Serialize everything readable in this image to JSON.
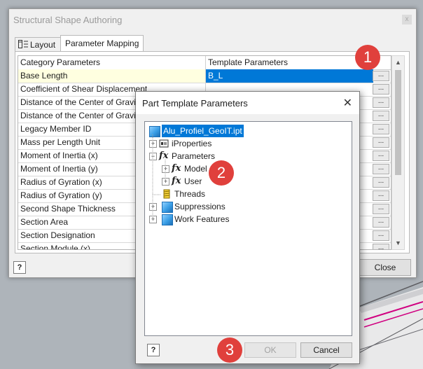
{
  "colors": {
    "accent": "#0078d7",
    "callout": "#e0403c",
    "selected_row": "#ffffe0"
  },
  "main_dialog": {
    "title": "Structural Shape Authoring",
    "close_glyph": "x",
    "tabs": [
      {
        "label": "Layout",
        "icon": "layout-icon"
      },
      {
        "label": "Parameter Mapping"
      }
    ],
    "grid": {
      "headers": [
        "Category Parameters",
        "Template Parameters"
      ],
      "rows": [
        {
          "category": "Base Length",
          "template": "B_L"
        },
        {
          "category": "Coefficient of Shear Displacement",
          "template": ""
        },
        {
          "category": "Distance of the Center of Gravity X",
          "template": ""
        },
        {
          "category": "Distance of the Center of Gravity Y",
          "template": ""
        },
        {
          "category": "Legacy Member ID",
          "template": ""
        },
        {
          "category": "Mass per Length Unit",
          "template": ""
        },
        {
          "category": "Moment of Inertia (x)",
          "template": ""
        },
        {
          "category": "Moment of Inertia (y)",
          "template": ""
        },
        {
          "category": "Radius of Gyration (x)",
          "template": ""
        },
        {
          "category": "Radius of Gyration (y)",
          "template": ""
        },
        {
          "category": "Second Shape Thickness",
          "template": ""
        },
        {
          "category": "Section Area",
          "template": ""
        },
        {
          "category": "Section Designation",
          "template": ""
        },
        {
          "category": "Section Module (x)",
          "template": ""
        }
      ],
      "browse_label": "..."
    },
    "help_glyph": "?",
    "close_button": "Close"
  },
  "part_template_dialog": {
    "title": "Part Template Parameters",
    "close_glyph": "✕",
    "tree": {
      "root": "Alu_Profiel_GeoIT.ipt",
      "iproperties": "iProperties",
      "parameters": "Parameters",
      "model": "Model",
      "user": "User",
      "threads": "Threads",
      "suppressions": "Suppressions",
      "work_features": "Work Features",
      "fx_glyph": "fx",
      "expand_glyph": "+",
      "collapse_glyph": "−"
    },
    "help_glyph": "?",
    "ok_button": "OK",
    "cancel_button": "Cancel"
  },
  "callouts": [
    "1",
    "2",
    "3"
  ]
}
